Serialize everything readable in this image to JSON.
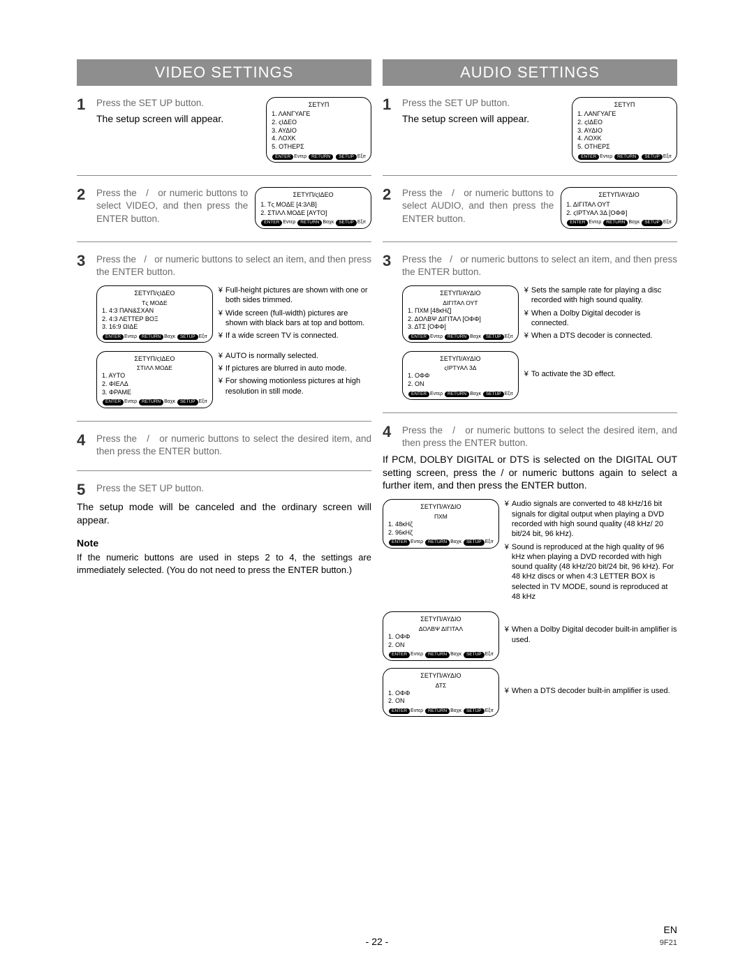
{
  "video": {
    "title": "VIDEO SETTINGS",
    "steps": {
      "s1": {
        "instr": "Press the SET UP button.",
        "sub": "The setup screen will appear."
      },
      "s2": {
        "instr": "Press the   /   or numeric buttons to select VIDEO, and then press the ENTER button."
      },
      "s3": {
        "instr": "Press the   /   or numeric buttons to select an item, and then press the ENTER button."
      },
      "s4": {
        "instr": "Press the   /   or numeric buttons to select the desired item, and then press the ENTER but­ton."
      },
      "s5": {
        "instr": "Press the SET UP button.",
        "body": "The setup mode will be canceled and the ordinary screen will appear."
      }
    },
    "osd_setup": {
      "title": "ΣΕΤΥΠ",
      "items": [
        "1. ΛΑΝΓΥΑΓΕ",
        "2. ςΙΔΕΟ",
        "3. ΑΥΔΙΟ",
        "4. ΛΟΧΚ",
        "5. ΟΤΗΕΡΣ"
      ]
    },
    "osd_video": {
      "title": "ΣΕΤΥΠ/ςΙΔΕΟ",
      "items": [
        "1. Τς ΜΟΔΕ          [4:3ΛΒ]",
        "2. ΣΤΙΛΛ ΜΟΔΕ   [ΑΥΤΟ]"
      ]
    },
    "osd_tvmode": {
      "title": "ΣΕΤΥΠ/ςΙΔΕΟ",
      "sub": "Τς ΜΟΔΕ",
      "items": [
        "1. 4:3 ΠΑΝ&ΣΧΑΝ",
        "2. 4:3 ΛΕΤΤΕΡ ΒΟΞ",
        "3. 16:9 ΩΙΔΕ"
      ]
    },
    "osd_still": {
      "title": "ΣΕΤΥΠ/ςΙΔΕΟ",
      "sub": "ΣΤΙΛΛ ΜΟΔΕ",
      "items": [
        "1. ΑΥΤΟ",
        "2. ΦΙΕΛΔ",
        "3. ΦΡΑΜΕ"
      ]
    },
    "callouts_tvmode": [
      "Full-height pictures are shown with one or both sides trimmed.",
      "Wide screen (full-width) pictures are shown with black bars at top and bottom.",
      "If a wide screen TV is connected."
    ],
    "callouts_still": [
      "AUTO is normally selected.",
      "If pictures are blurred in auto mode.",
      "For showing motionless pictures at high resolution in still mode."
    ],
    "note_head": "Note",
    "note_body": "If the numeric buttons are used in steps 2 to 4, the settings are immediately selected. (You do not need to press the ENTER button.)"
  },
  "audio": {
    "title": "AUDIO SETTINGS",
    "steps": {
      "s1": {
        "instr": "Press the SET UP button.",
        "sub": "The setup screen will appear."
      },
      "s2": {
        "instr": "Press the   /   or numeric buttons to select AUDIO, and then press the ENTER button."
      },
      "s3": {
        "instr": "Press the   /   or numeric buttons to select an item, and then press the ENTER button."
      },
      "s4": {
        "instr": "Press the   /   or numeric buttons to select the desired item, and then press the ENTER button.",
        "body": "If PCM, DOLBY DIGITAL or DTS is selected on the DIGITAL OUT setting screen, press the   /   or numeric buttons again to select a further item, and then press the ENTER button."
      }
    },
    "osd_setup": {
      "title": "ΣΕΤΥΠ",
      "items": [
        "1. ΛΑΝΓΥΑΓΕ",
        "2. ςΙΔΕΟ",
        "3. ΑΥΔΙΟ",
        "4. ΛΟΧΚ",
        "5. ΟΤΗΕΡΣ"
      ]
    },
    "osd_audio": {
      "title": "ΣΕΤΥΠ/ΑΥΔΙΟ",
      "items": [
        "1. ΔΙΓΙΤΑΛ ΟΥΤ",
        "2. ςΙΡΤΥΑΛ 3Δ     [ΟΦΦ]"
      ]
    },
    "osd_digout": {
      "title": "ΣΕΤΥΠ/ΑΥΔΙΟ",
      "sub": "ΔΙΓΙΤΑΛ ΟΥΤ",
      "items": [
        "1. ΠΧΜ                    [48κΗζ]",
        "2. ΔΟΛΒΨ ΔΙΓΙΤΑΛ [ΟΦΦ]",
        "3. ΔΤΣ                    [ΟΦΦ]"
      ]
    },
    "osd_v3d": {
      "title": "ΣΕΤΥΠ/ΑΥΔΙΟ",
      "sub": "ςΙΡΤΥΑΛ 3Δ",
      "items": [
        "1. ΟΦΦ",
        "2. ΟΝ"
      ]
    },
    "osd_pcm": {
      "title": "ΣΕΤΥΠ/ΑΥΔΙΟ",
      "sub": "ΠΧΜ",
      "items": [
        "1. 48κΗζ",
        "2. 96κΗζ"
      ]
    },
    "osd_dolby": {
      "title": "ΣΕΤΥΠ/ΑΥΔΙΟ",
      "sub": "ΔΟΛΒΨ ΔΙΓΙΤΑΛ",
      "items": [
        "1. ΟΦΦ",
        "2. ΟΝ"
      ]
    },
    "osd_dts": {
      "title": "ΣΕΤΥΠ/ΑΥΔΙΟ",
      "sub": "ΔΤΣ",
      "items": [
        "1. ΟΦΦ",
        "2. ΟΝ"
      ]
    },
    "callouts_digout": [
      "Sets the sample rate for playing a disc recorded with high sound quality.",
      "When a Dolby Digital decoder is connected.",
      "When a DTS decoder is connected."
    ],
    "callouts_v3d": [
      "To activate the 3D effect."
    ],
    "callouts_pcm": [
      "Audio signals are converted to 48 kHz/16 bit signals for digital output when playing a DVD recorded with high sound quality (48 kHz/ 20 bit/24 bit, 96 kHz).",
      "Sound is reproduced at the high quality of 96 kHz when playing a DVD recorded with high sound quality (48 kHz/20 bit/24 bit, 96 kHz). For 48 kHz discs or when 4:3 LETTER BOX is selected in TV MODE, sound is reproduced at 48 kHz"
    ],
    "callouts_dolby": [
      "When a Dolby Digital decoder built-in amplifier is used."
    ],
    "callouts_dts": [
      "When a DTS decoder built-in amplifier is used."
    ]
  },
  "osd_foot": {
    "enter": "ENTER",
    "enterT": "Εντερ",
    "return": "RETURN",
    "returnT": "Βαχκ",
    "setup": "SETUP",
    "setupT": "Εξιτ"
  },
  "footer": {
    "page": "- 22 -",
    "lang": "EN",
    "code": "9F21"
  }
}
